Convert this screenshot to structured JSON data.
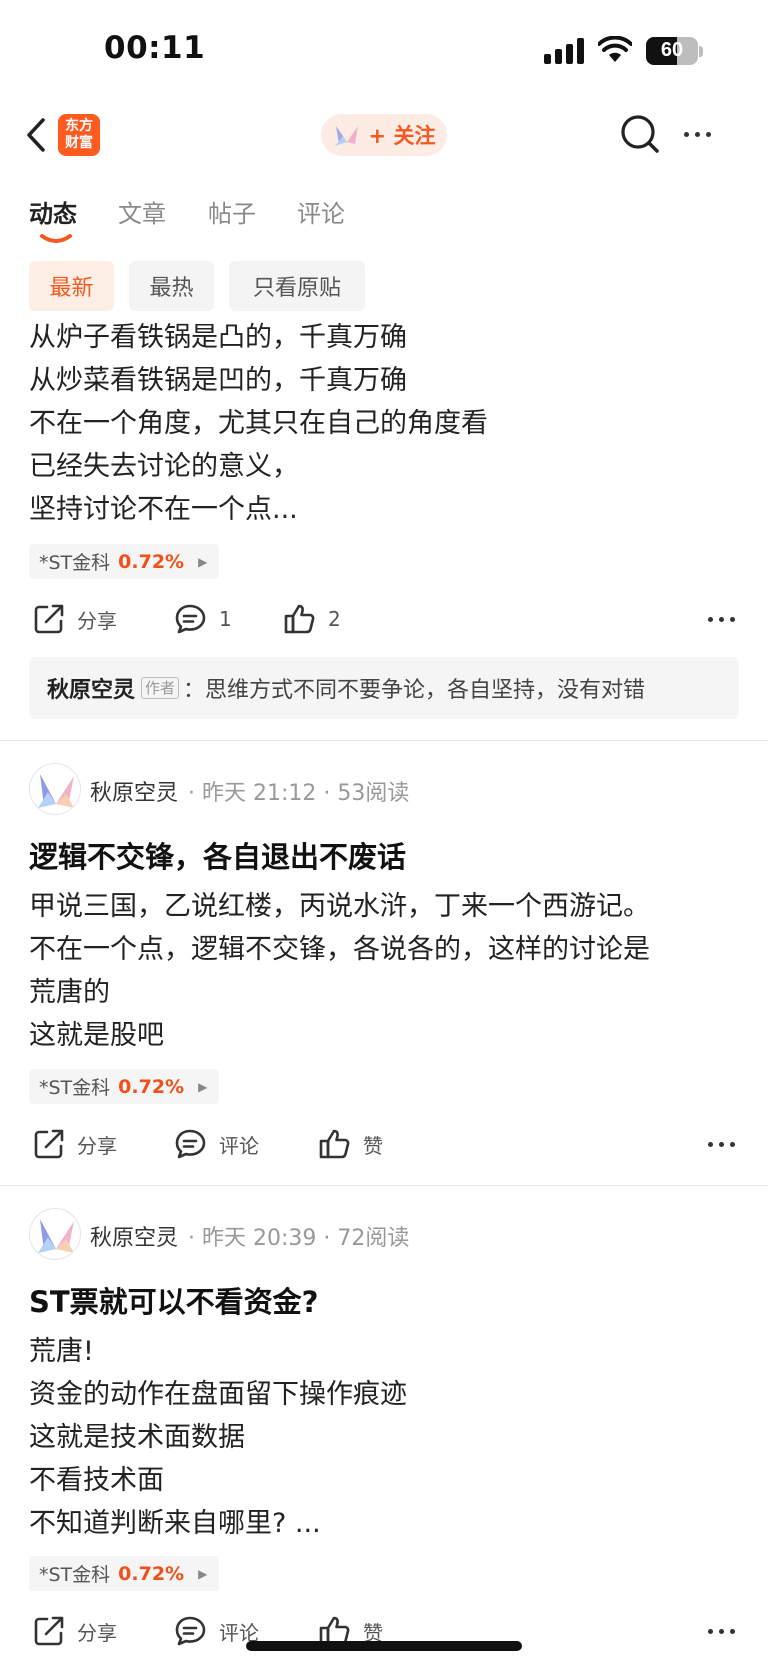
{
  "status_bar": {
    "time": "00:11",
    "battery": "60"
  },
  "nav": {
    "logo_line1": "东方",
    "logo_line2": "财富",
    "follow_label": "+ 关注"
  },
  "tabs": [
    "动态",
    "文章",
    "帖子",
    "评论"
  ],
  "filters": [
    "最新",
    "最热",
    "只看原贴"
  ],
  "post1": {
    "lines": [
      "从炉子看铁锅是凸的，千真万确",
      "从炒菜看铁锅是凹的，千真万确",
      "不在一个角度，尤其只在自己的角度看",
      "已经失去讨论的意义，",
      "坚持讨论不在一个点..."
    ],
    "stock_name": "*ST金科",
    "stock_pct": "0.72%",
    "share": "分享",
    "comments": "1",
    "likes": "2",
    "comment_author": "秋原空灵",
    "comment_tag": "作者",
    "comment_text": "：思维方式不同不要争论，各自坚持，没有对错"
  },
  "post2": {
    "author": "秋原空灵",
    "meta": "· 昨天 21:12 · 53阅读",
    "title": "逻辑不交锋，各自退出不废话",
    "lines": [
      "甲说三国，乙说红楼，丙说水浒，丁来一个西游记。",
      "不在一个点，逻辑不交锋，各说各的，这样的讨论是",
      "荒唐的",
      "这就是股吧"
    ],
    "stock_name": "*ST金科",
    "stock_pct": "0.72%",
    "share": "分享",
    "comment": "评论",
    "like": "赞"
  },
  "post3": {
    "author": "秋原空灵",
    "meta": "· 昨天 20:39 · 72阅读",
    "title": "ST票就可以不看资金?",
    "lines": [
      "荒唐!",
      "资金的动作在盘面留下操作痕迹",
      "这就是技术面数据",
      "不看技术面",
      "不知道判断来自哪里? ..."
    ],
    "stock_name": "*ST金科",
    "stock_pct": "0.72%",
    "share": "分享",
    "comment": "评论",
    "like": "赞"
  },
  "colors": {
    "accent": "#f4591f",
    "brand": "#ff5a1f"
  }
}
